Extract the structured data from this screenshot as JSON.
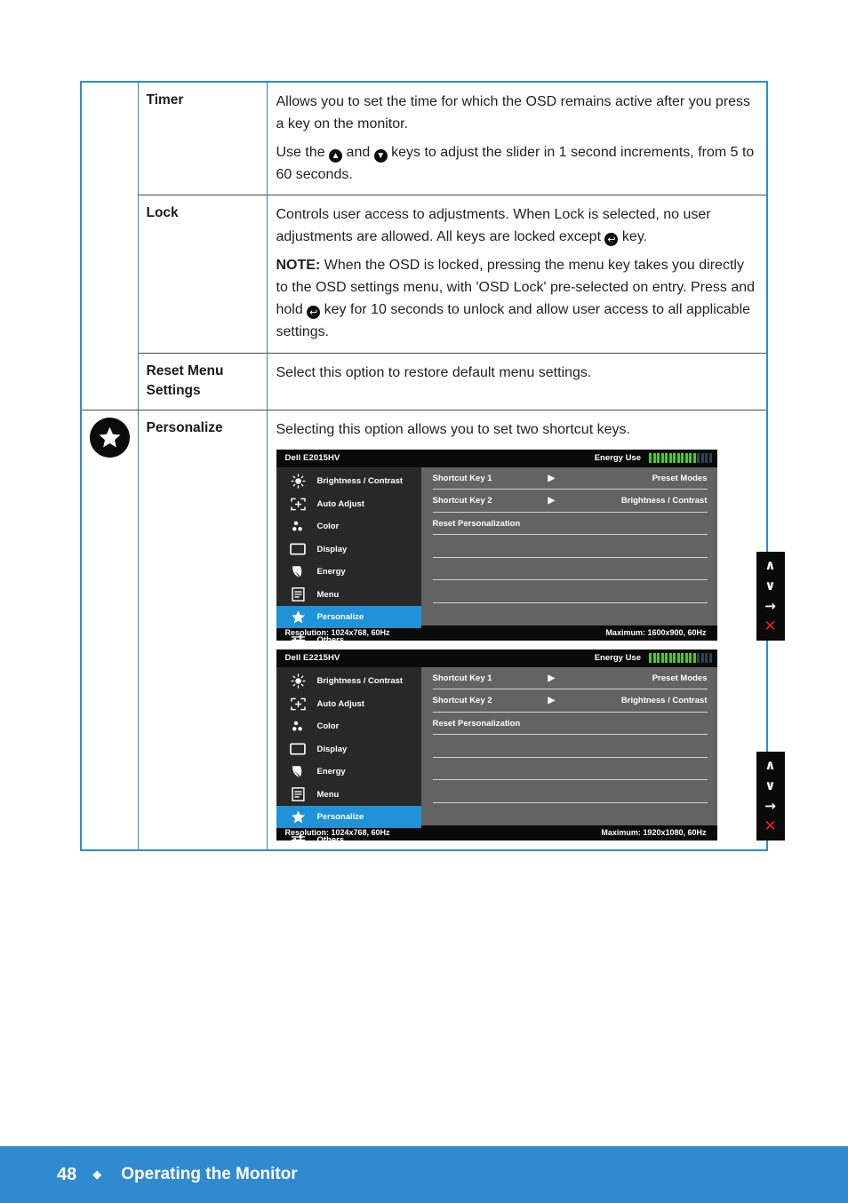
{
  "page": {
    "number": "48",
    "separator": "◆",
    "footer_title": "Operating the Monitor",
    "accent_color": "#2f8ad0"
  },
  "table": {
    "rows": [
      {
        "label": "Timer",
        "paragraphs": [
          "Allows you to set the time for which the OSD remains active after you press a key on the monitor.",
          "Use the ▲ and ▼ keys to adjust the slider in 1 second increments, from 5 to 60 seconds."
        ]
      },
      {
        "label": "Lock",
        "paragraphs": [
          "Controls user access to adjustments. When Lock is selected, no user adjustments are allowed. All keys are locked except ↶ key.",
          "NOTE: When the OSD is locked, pressing the menu key takes you directly to the OSD settings menu, with 'OSD Lock' pre-selected on entry. Press and hold ↶ key for 10 seconds to unlock and allow user access to all applicable settings."
        ]
      },
      {
        "label": "Reset Menu Settings",
        "paragraphs": [
          "Select this option to restore default menu settings."
        ]
      },
      {
        "label": "Personalize",
        "paragraphs": [
          "Selecting this option allows you to set two shortcut keys."
        ]
      }
    ],
    "timer_line2": {
      "pre": "Use the ",
      "mid": " and ",
      "post": " keys to adjust the slider in 1 second increments, from 5 to 60 seconds."
    },
    "lock_line1": {
      "pre": "Controls user access to adjustments. When Lock is selected, no user adjustments are allowed. All keys are locked except ",
      "post": " key."
    },
    "lock_note": {
      "bold": "NOTE:",
      "pre": " When the OSD is locked, pressing the menu key takes you directly to the OSD settings menu, with 'OSD Lock' pre-selected on entry. Press and hold ",
      "post": " key for 10 seconds to unlock and allow user access to all applicable settings."
    },
    "personalize_icon": "star-icon"
  },
  "osd_menus": [
    {
      "model": "Dell E2015HV",
      "energy_label": "Energy Use",
      "energy_on": 12,
      "energy_off": 4,
      "sidebar": [
        {
          "label": "Brightness / Contrast",
          "icon": "brightness-icon",
          "active": false
        },
        {
          "label": "Auto Adjust",
          "icon": "auto-adjust-icon",
          "active": false
        },
        {
          "label": "Color",
          "icon": "color-icon",
          "active": false
        },
        {
          "label": "Display",
          "icon": "display-icon",
          "active": false
        },
        {
          "label": "Energy",
          "icon": "energy-leaf-icon",
          "active": false
        },
        {
          "label": "Menu",
          "icon": "menu-icon",
          "active": false
        },
        {
          "label": "Personalize",
          "icon": "star-icon",
          "active": true
        },
        {
          "label": "Others",
          "icon": "others-sliders-icon",
          "active": false
        }
      ],
      "rows": [
        {
          "key": "Shortcut Key 1",
          "arrow": "▶",
          "value": "Preset Modes"
        },
        {
          "key": "Shortcut Key 2",
          "arrow": "▶",
          "value": "Brightness / Contrast"
        },
        {
          "key": "Reset Personalization",
          "arrow": "",
          "value": ""
        }
      ],
      "resolution": "Resolution: 1024x768, 60Hz",
      "maximum": "Maximum: 1600x900, 60Hz",
      "keys": [
        "∧",
        "∨",
        "→",
        "✕"
      ]
    },
    {
      "model": "Dell E2215HV",
      "energy_label": "Energy Use",
      "energy_on": 12,
      "energy_off": 4,
      "sidebar": [
        {
          "label": "Brightness / Contrast",
          "icon": "brightness-icon",
          "active": false
        },
        {
          "label": "Auto Adjust",
          "icon": "auto-adjust-icon",
          "active": false
        },
        {
          "label": "Color",
          "icon": "color-icon",
          "active": false
        },
        {
          "label": "Display",
          "icon": "display-icon",
          "active": false
        },
        {
          "label": "Energy",
          "icon": "energy-leaf-icon",
          "active": false
        },
        {
          "label": "Menu",
          "icon": "menu-icon",
          "active": false
        },
        {
          "label": "Personalize",
          "icon": "star-icon",
          "active": true
        },
        {
          "label": "Others",
          "icon": "others-sliders-icon",
          "active": false
        }
      ],
      "rows": [
        {
          "key": "Shortcut Key 1",
          "arrow": "▶",
          "value": "Preset Modes"
        },
        {
          "key": "Shortcut Key 2",
          "arrow": "▶",
          "value": "Brightness / Contrast"
        },
        {
          "key": "Reset Personalization",
          "arrow": "",
          "value": ""
        }
      ],
      "resolution": "Resolution: 1024x768, 60Hz",
      "maximum": "Maximum: 1920x1080, 60Hz",
      "keys": [
        "∧",
        "∨",
        "→",
        "✕"
      ]
    }
  ]
}
